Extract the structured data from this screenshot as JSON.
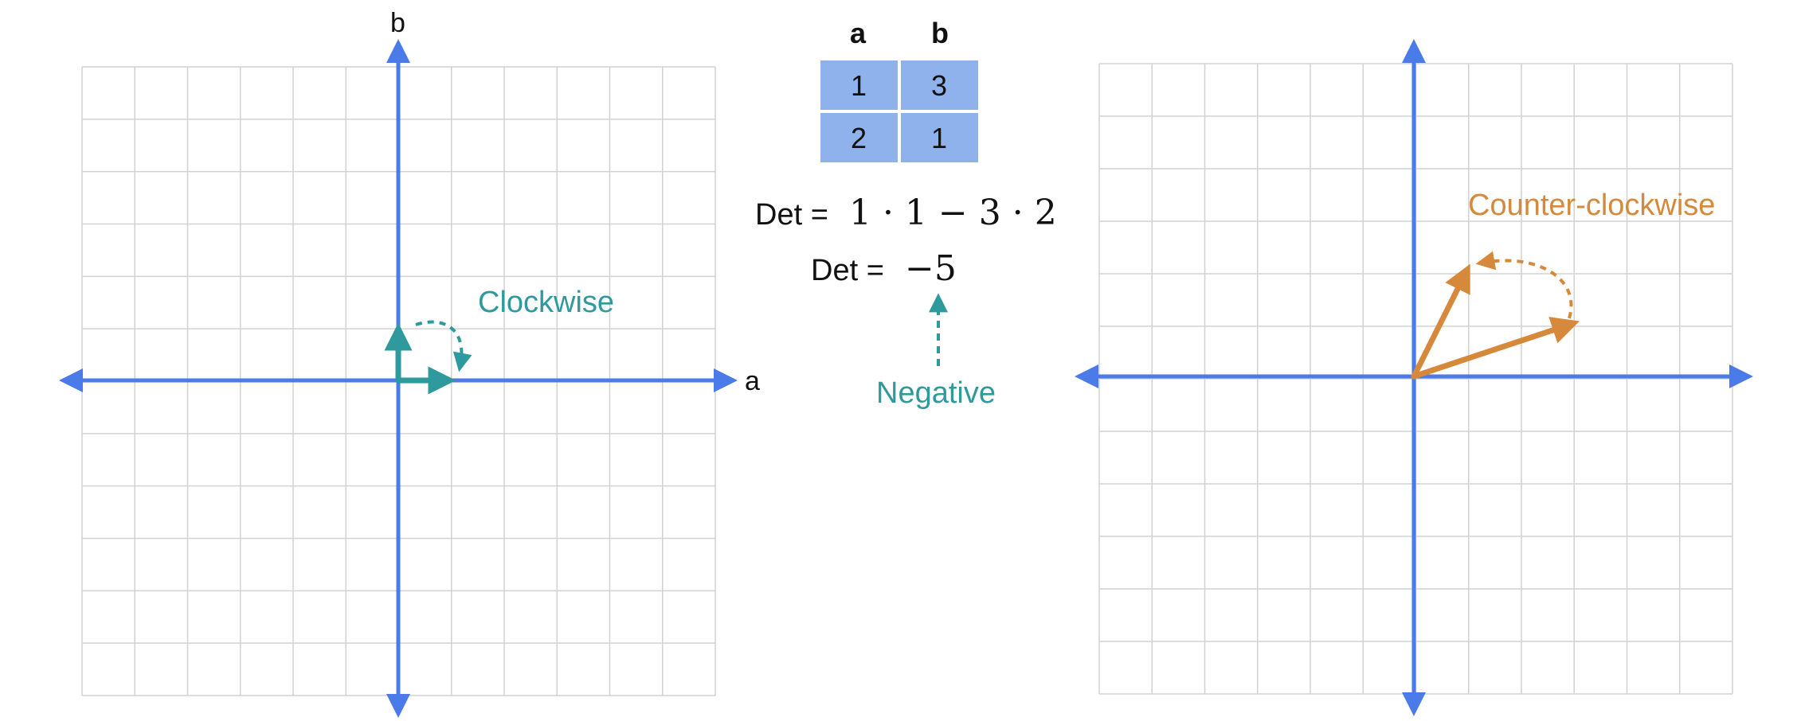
{
  "colors": {
    "grid": "#d2d2d2",
    "axis": "#4a7be8",
    "clockwise": "#2f9a9e",
    "counter_clockwise": "#d6893a",
    "cell_fill": "#8fb1ec",
    "text": "#111111"
  },
  "left_plot": {
    "x_axis_label": "a",
    "y_axis_label": "b",
    "rotation_label": "Clockwise",
    "vectors": [
      {
        "name": "a-vector",
        "x": 1,
        "y": 0
      },
      {
        "name": "b-vector",
        "x": 0,
        "y": 1
      }
    ]
  },
  "matrix": {
    "headers": [
      "a",
      "b"
    ],
    "rows": [
      [
        "1",
        "3"
      ],
      [
        "2",
        "1"
      ]
    ]
  },
  "determinant": {
    "line1_prefix": "Det =",
    "line1_expr": "1 · 1 − 3 · 2",
    "line2_prefix": "Det =",
    "line2_expr": "−5",
    "sign_label": "Negative"
  },
  "right_plot": {
    "rotation_label": "Counter-clockwise",
    "vectors": [
      {
        "name": "a-vector",
        "x": 3,
        "y": 1
      },
      {
        "name": "b-vector",
        "x": 1,
        "y": 2
      }
    ]
  }
}
